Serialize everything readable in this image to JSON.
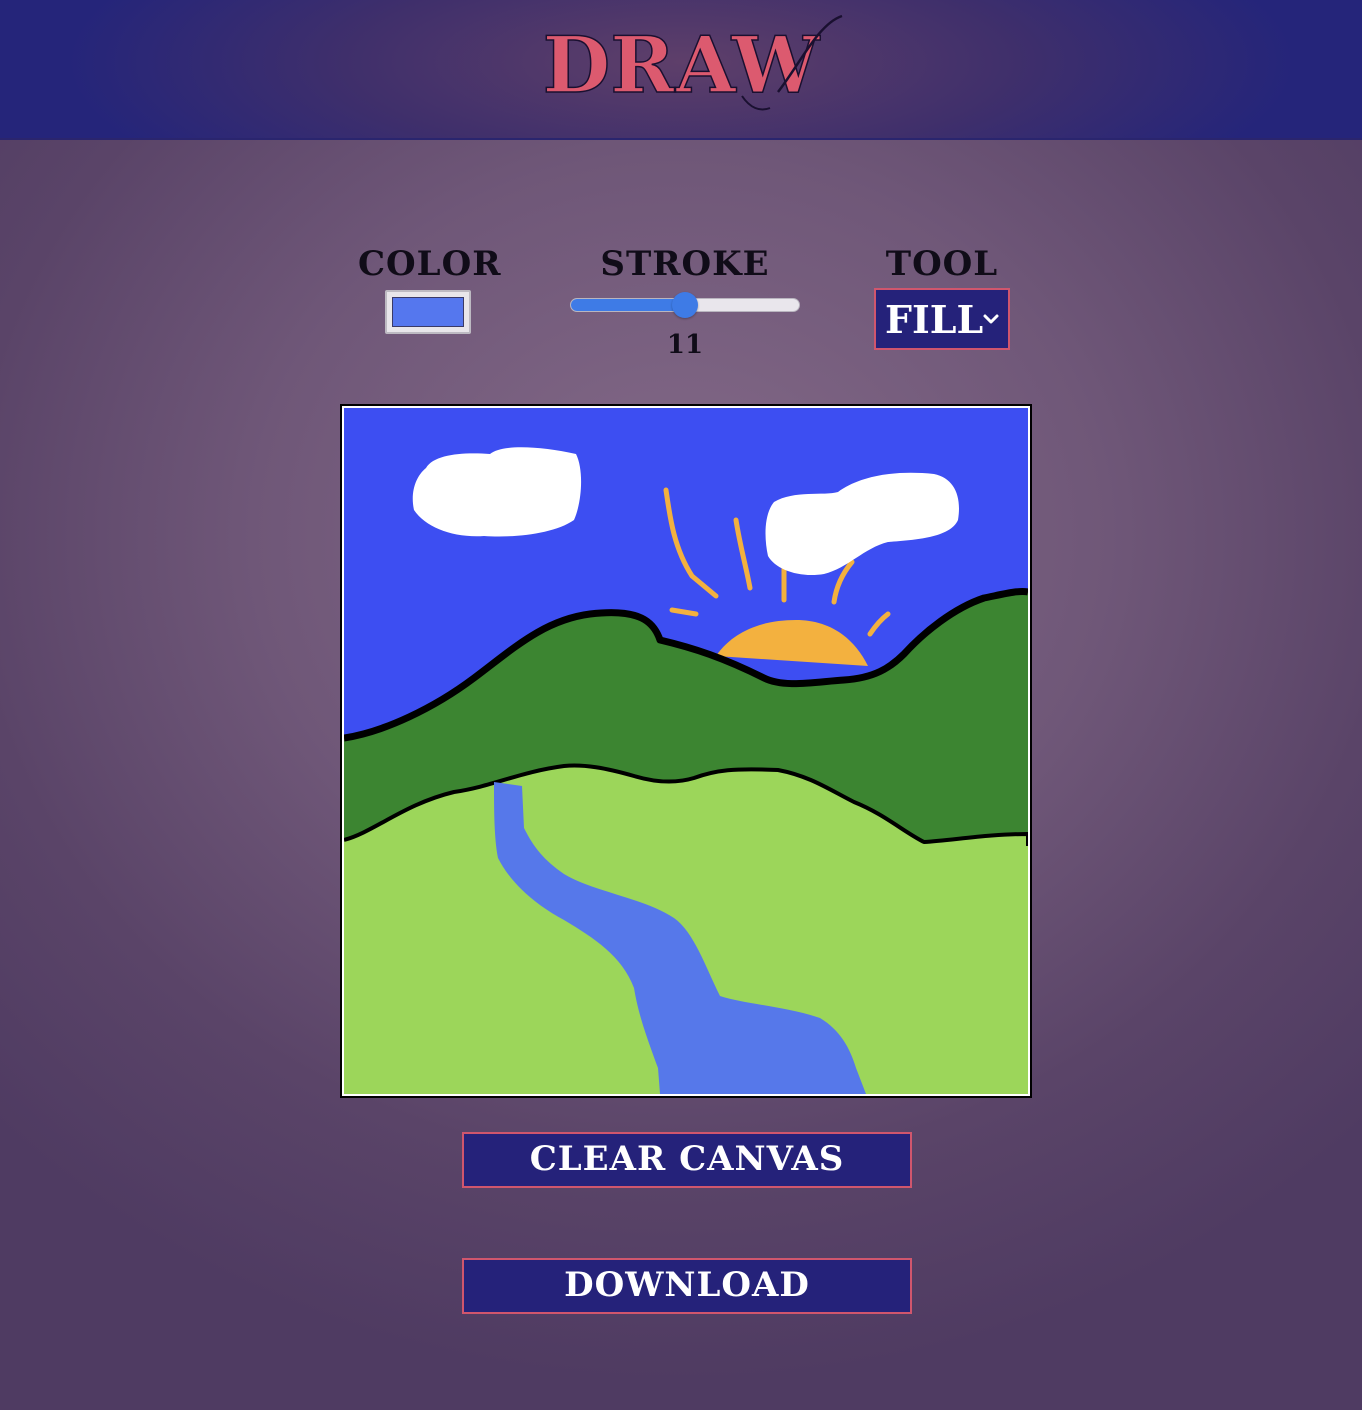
{
  "app": {
    "title": "DRAW"
  },
  "controls": {
    "color": {
      "label": "COLOR",
      "value": "#5577ee"
    },
    "stroke": {
      "label": "STROKE",
      "value": "11",
      "min": 1,
      "max": 21
    },
    "tool": {
      "label": "TOOL",
      "selected": "FILL"
    }
  },
  "canvas": {
    "sky_color": "#3d4ef2",
    "hill_back_color": "#3c8531",
    "hill_front_color": "#9cd65a",
    "river_color": "#5678ea",
    "sun_color": "#f3b13f",
    "cloud_color": "#ffffff",
    "outline_color": "#000000"
  },
  "buttons": {
    "clear": "CLEAR CANVAS",
    "download": "DOWNLOAD"
  },
  "theme": {
    "accent": "#d0566d",
    "button_bg": "#25227a",
    "logo_color": "#dc5a6f"
  }
}
